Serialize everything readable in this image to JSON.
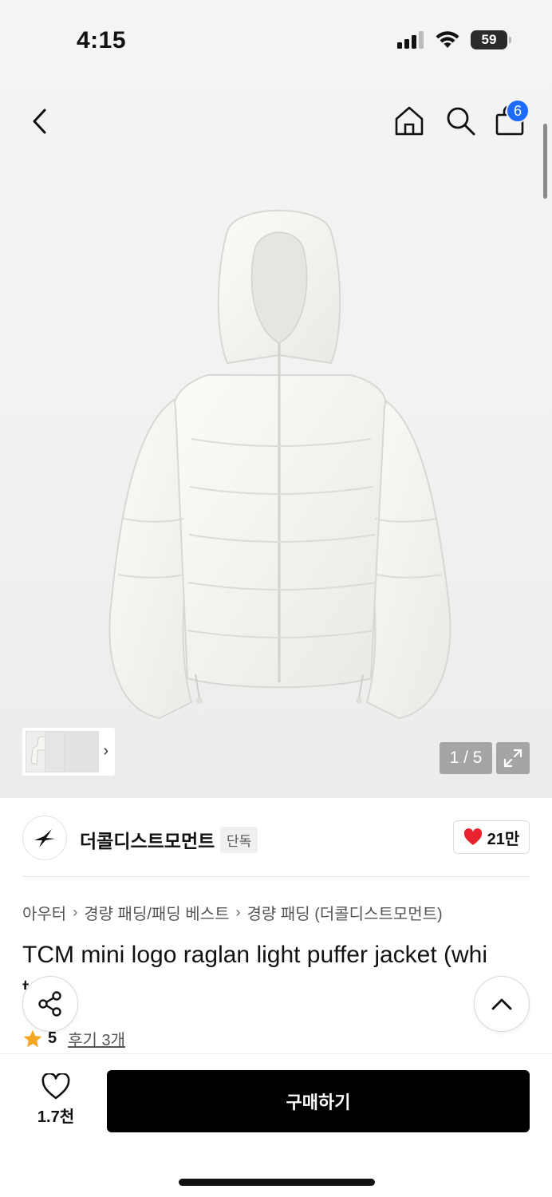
{
  "status": {
    "time": "4:15",
    "battery": "59"
  },
  "nav": {
    "cart_count": "6"
  },
  "gallery": {
    "page_indicator": "1 / 5"
  },
  "brand": {
    "name": "더콜디스트모먼트",
    "tag": "단독",
    "likes": "21만"
  },
  "breadcrumb": [
    "아우터",
    "경량 패딩/패딩 베스트",
    "경량 패딩 (더콜디스트모먼트)"
  ],
  "product": {
    "title": "TCM mini logo raglan light puffer jacket (whi",
    "title_cont": "t",
    "rating": "5",
    "reviews": "후기 3개"
  },
  "bottom": {
    "wish_count": "1.7천",
    "buy_label": "구매하기"
  },
  "colors": {
    "accent_blue": "#1f6bff",
    "heart_red": "#e8232f",
    "star": "#f5a623",
    "buy_bg": "#000000"
  },
  "icons": [
    "back-icon",
    "home-icon",
    "search-icon",
    "bag-icon",
    "expand-icon",
    "share-icon",
    "chevron-up-icon",
    "heart-icon",
    "star-icon"
  ]
}
